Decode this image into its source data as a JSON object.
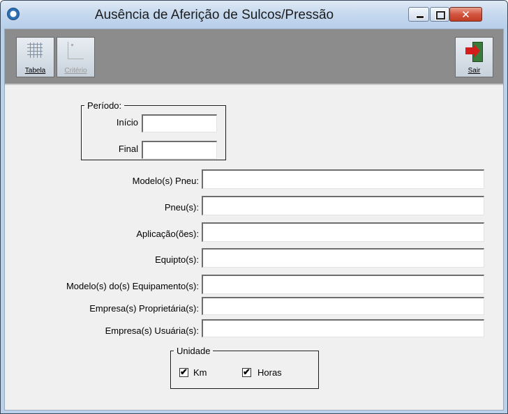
{
  "window": {
    "title": "Ausência de Aferição de Sulcos/Pressão",
    "app_icon": "app-logo-icon",
    "controls": {
      "minimize": "minimize-icon",
      "maximize": "maximize-icon",
      "close_glyph": "✕"
    }
  },
  "toolbar": {
    "tabela_label": "Tabela",
    "criterio_label": "Critério",
    "sair_label": "Sair",
    "tabela_icon": "grid-table-icon",
    "criterio_icon": "criteria-icon",
    "sair_icon": "exit-door-icon"
  },
  "periodo": {
    "legend": "Período:",
    "inicio_label": "Início",
    "inicio_value": "",
    "final_label": "Final",
    "final_value": ""
  },
  "fields": {
    "modelo_pneu_label": "Modelo(s) Pneu:",
    "modelo_pneu_value": "",
    "pneu_label": "Pneu(s):",
    "pneu_value": "",
    "aplicacao_label": "Aplicação(ões):",
    "aplicacao_value": "",
    "equipto_label": "Equipto(s):",
    "equipto_value": "",
    "modelo_equip_label": "Modelo(s) do(s) Equipamento(s):",
    "modelo_equip_value": "",
    "empresa_prop_label": "Empresa(s) Proprietária(s):",
    "empresa_prop_value": "",
    "empresa_usu_label": "Empresa(s) Usuária(s):",
    "empresa_usu_value": ""
  },
  "unidade": {
    "legend": "Unidade",
    "km_label": "Km",
    "km_checked": true,
    "horas_label": "Horas",
    "horas_checked": true,
    "check_mark": "✔"
  }
}
